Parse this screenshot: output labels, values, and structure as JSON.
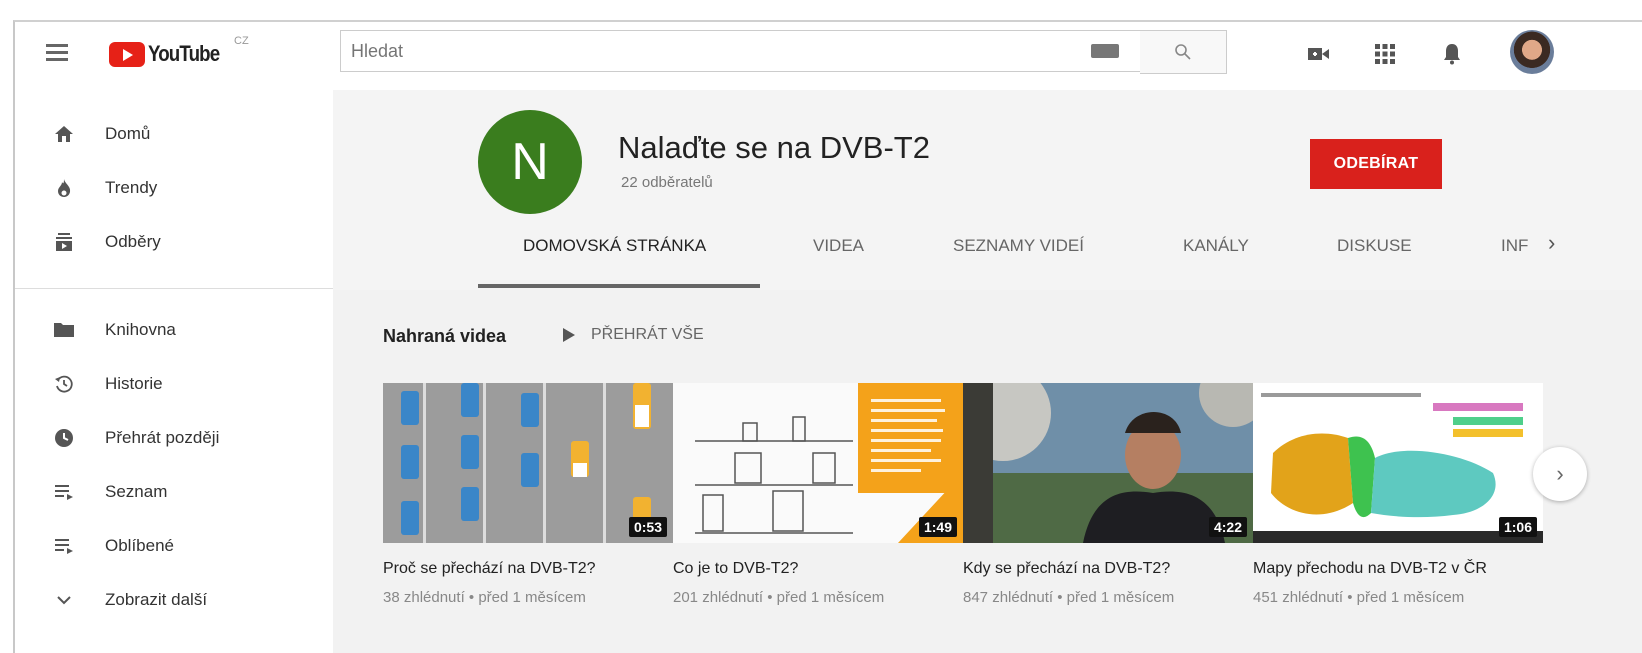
{
  "header": {
    "logo_text": "YouTube",
    "country_code": "CZ",
    "search_placeholder": "Hledat"
  },
  "sidebar": {
    "items": [
      {
        "label": "Domů",
        "icon": "home-icon"
      },
      {
        "label": "Trendy",
        "icon": "flame-icon"
      },
      {
        "label": "Odběry",
        "icon": "subscriptions-icon"
      },
      {
        "label": "Knihovna",
        "icon": "folder-icon"
      },
      {
        "label": "Historie",
        "icon": "history-icon"
      },
      {
        "label": "Přehrát později",
        "icon": "clock-icon"
      },
      {
        "label": "Seznam",
        "icon": "playlist-icon"
      },
      {
        "label": "Oblíbené",
        "icon": "playlist-icon"
      },
      {
        "label": "Zobrazit další",
        "icon": "chevron-down-icon"
      }
    ]
  },
  "channel": {
    "avatar_letter": "N",
    "avatar_color": "#3a7d1e",
    "name": "Nalaďte se na DVB-T2",
    "subscribers": "22 odběratelů",
    "subscribe_label": "ODEBÍRAT",
    "subscribe_color": "#d9211c"
  },
  "tabs": [
    {
      "label": "DOMOVSKÁ STRÁNKA",
      "active": true
    },
    {
      "label": "VIDEA",
      "active": false
    },
    {
      "label": "SEZNAMY VIDEÍ",
      "active": false
    },
    {
      "label": "KANÁLY",
      "active": false
    },
    {
      "label": "DISKUSE",
      "active": false
    },
    {
      "label": "INF",
      "active": false
    }
  ],
  "section": {
    "title": "Nahraná videa",
    "play_all": "PŘEHRÁT VŠE"
  },
  "videos": [
    {
      "title": "Proč se přechází na DVB-T2?",
      "duration": "0:53",
      "meta": "38 zhlédnutí • před 1 měsícem"
    },
    {
      "title": "Co je to DVB-T2?",
      "duration": "1:49",
      "meta": "201 zhlédnutí • před 1 měsícem"
    },
    {
      "title": "Kdy se přechází na DVB-T2?",
      "duration": "4:22",
      "meta": "847 zhlédnutí • před 1 měsícem"
    },
    {
      "title": "Mapy přechodu na DVB-T2 v ČR",
      "duration": "1:06",
      "meta": "451 zhlédnutí • před 1 měsícem"
    }
  ]
}
